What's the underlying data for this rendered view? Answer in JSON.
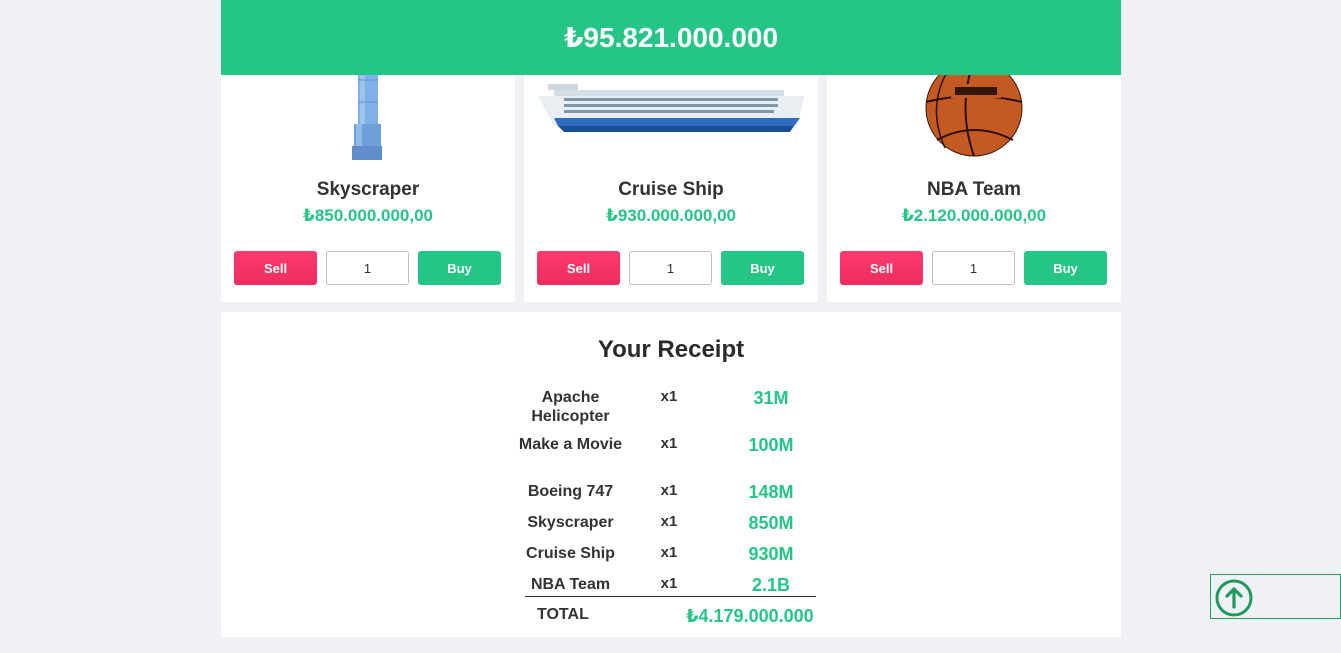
{
  "header": {
    "money": "₺95.821.000.000"
  },
  "products": [
    {
      "name": "Skyscraper",
      "price": "₺850.000.000,00",
      "sell_label": "Sell",
      "buy_label": "Buy",
      "quantity": "1"
    },
    {
      "name": "Cruise Ship",
      "price": "₺930.000.000,00",
      "sell_label": "Sell",
      "buy_label": "Buy",
      "quantity": "1"
    },
    {
      "name": "NBA Team",
      "price": "₺2.120.000.000,00",
      "sell_label": "Sell",
      "buy_label": "Buy",
      "quantity": "1"
    }
  ],
  "receipt": {
    "title": "Your Receipt",
    "items": [
      {
        "name": "Apache Helicopter",
        "qty": "x1",
        "amount": "31M"
      },
      {
        "name": "Make a Movie",
        "qty": "x1",
        "amount": "100M"
      },
      {
        "name": "Boeing 747",
        "qty": "x1",
        "amount": "148M"
      },
      {
        "name": "Skyscraper",
        "qty": "x1",
        "amount": "850M"
      },
      {
        "name": "Cruise Ship",
        "qty": "x1",
        "amount": "930M"
      },
      {
        "name": "NBA Team",
        "qty": "x1",
        "amount": "2.1B"
      }
    ],
    "total_label": "TOTAL",
    "total_value": "₺4.179.000.000"
  },
  "colors": {
    "accent": "#24c587",
    "sell": "#f03063",
    "background": "#f0f1f5"
  },
  "icons": {
    "scroll_top": "arrow-up-circle-icon"
  }
}
